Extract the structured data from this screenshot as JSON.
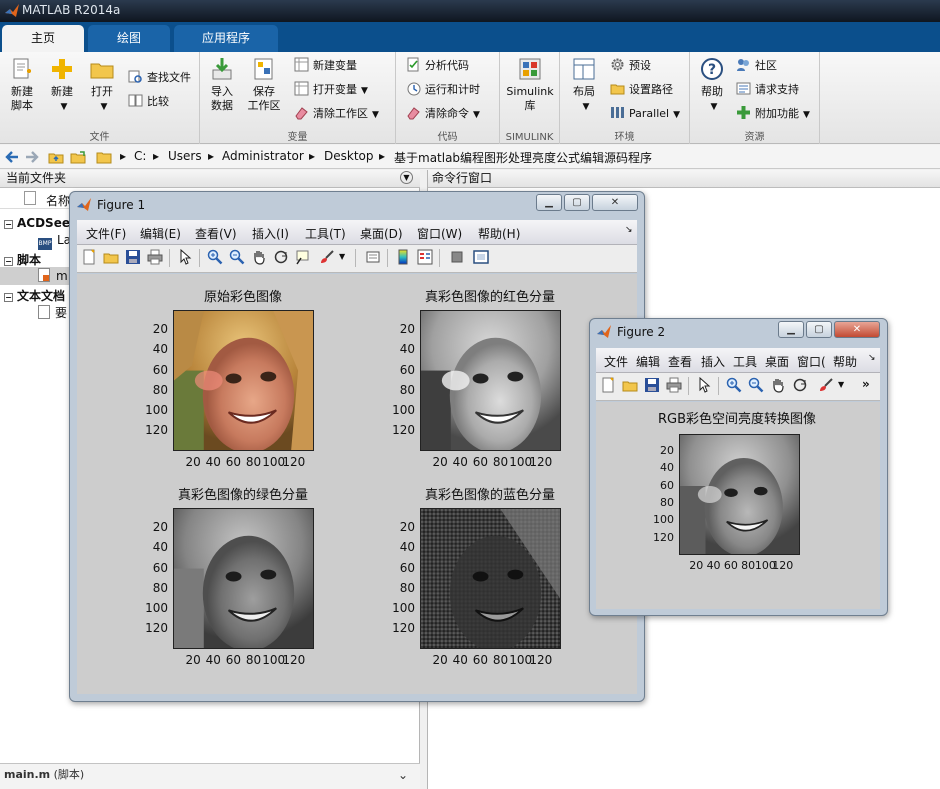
{
  "app": {
    "title": "MATLAB R2014a"
  },
  "tabs": [
    {
      "label": "主页",
      "active": true
    },
    {
      "label": "绘图",
      "active": false
    },
    {
      "label": "应用程序",
      "active": false
    }
  ],
  "ribbon": {
    "file": {
      "label": "文件",
      "new_script": "新建\n脚本",
      "new": "新建",
      "open": "打开",
      "find_files": "查找文件",
      "compare": "比较"
    },
    "variable": {
      "label": "变量",
      "import": "导入\n数据",
      "save_ws": "保存\n工作区",
      "new_var": "新建变量",
      "open_var": "打开变量",
      "clear_ws": "清除工作区"
    },
    "code": {
      "label": "代码",
      "analyze": "分析代码",
      "run_time": "运行和计时",
      "clear_cmd": "清除命令"
    },
    "simulink": {
      "label": "SIMULINK",
      "lib": "Simulink\n库"
    },
    "env": {
      "label": "环境",
      "layout": "布局",
      "prefs": "预设",
      "setpath": "设置路径",
      "parallel": "Parallel"
    },
    "resources": {
      "label": "资源",
      "help": "帮助",
      "community": "社区",
      "support": "请求支持",
      "addons": "附加功能"
    }
  },
  "address": {
    "parts": [
      "C:",
      "Users",
      "Administrator",
      "Desktop",
      "基于matlab编程图形处理亮度公式编辑源码程序"
    ]
  },
  "left_pane": {
    "title": "当前文件夹",
    "col_name": "名称",
    "groups": [
      {
        "label": "ACDSee",
        "file": "La"
      },
      {
        "label": "脚本",
        "file": "m"
      },
      {
        "label": "文本文档",
        "file": "要"
      }
    ],
    "footer": "main.m",
    "footer_type": "(脚本)"
  },
  "right_pane": {
    "title": "命令行窗口"
  },
  "figure1": {
    "title": "Figure 1",
    "menu": [
      "文件(F)",
      "编辑(E)",
      "查看(V)",
      "插入(I)",
      "工具(T)",
      "桌面(D)",
      "窗口(W)",
      "帮助(H)"
    ],
    "plots": [
      {
        "title": "原始彩色图像"
      },
      {
        "title": "真彩色图像的红色分量"
      },
      {
        "title": "真彩色图像的绿色分量"
      },
      {
        "title": "真彩色图像的蓝色分量"
      }
    ]
  },
  "figure2": {
    "title": "Figure 2",
    "menu": [
      "文件",
      "编辑",
      "查看",
      "插入",
      "工具",
      "桌面",
      "窗口(",
      "帮助"
    ],
    "plot": {
      "title": "RGB彩色空间亮度转换图像"
    }
  },
  "axis": {
    "y_ticks": [
      "20",
      "40",
      "60",
      "80",
      "100",
      "120"
    ],
    "x_ticks": [
      "20",
      "40",
      "60",
      "80",
      "100",
      "120"
    ]
  },
  "colors": {
    "tabstrip": "#0b4f8c",
    "figure_bg": "#cdcdcd",
    "matlab_orange": "#e1651b"
  }
}
